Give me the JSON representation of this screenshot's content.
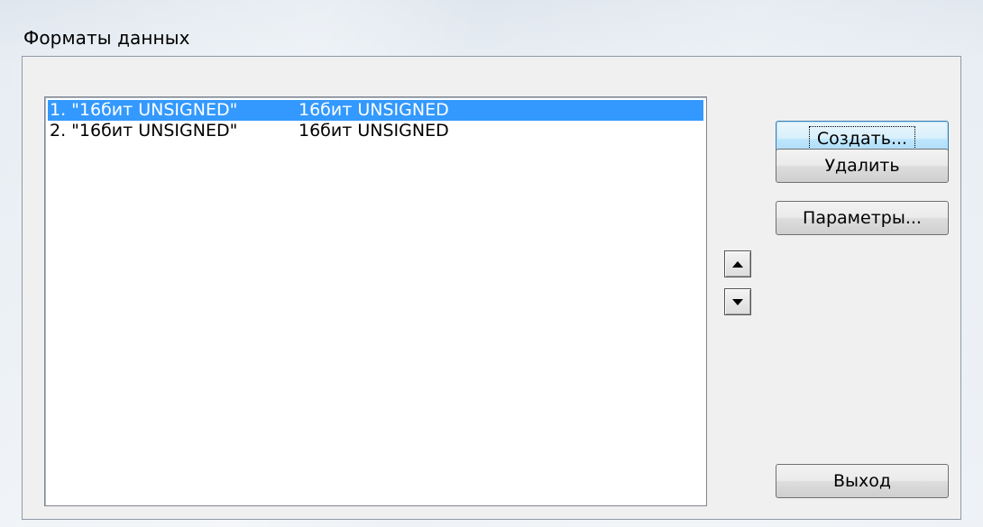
{
  "window": {
    "title": "Форматы данных"
  },
  "list": {
    "items": [
      {
        "name": "1. \"16бит UNSIGNED\"",
        "format": "16бит UNSIGNED",
        "selected": true
      },
      {
        "name": "2. \"16бит UNSIGNED\"",
        "format": "16бит UNSIGNED",
        "selected": false
      }
    ]
  },
  "buttons": {
    "create_label": "Создать...",
    "delete_label": "Удалить",
    "params_label": "Параметры...",
    "exit_label": "Выход"
  },
  "icons": {
    "move_up": "arrow-up-icon",
    "move_down": "arrow-down-icon"
  },
  "colors": {
    "selection": "#3399ff",
    "selection_text": "#ffffff"
  }
}
